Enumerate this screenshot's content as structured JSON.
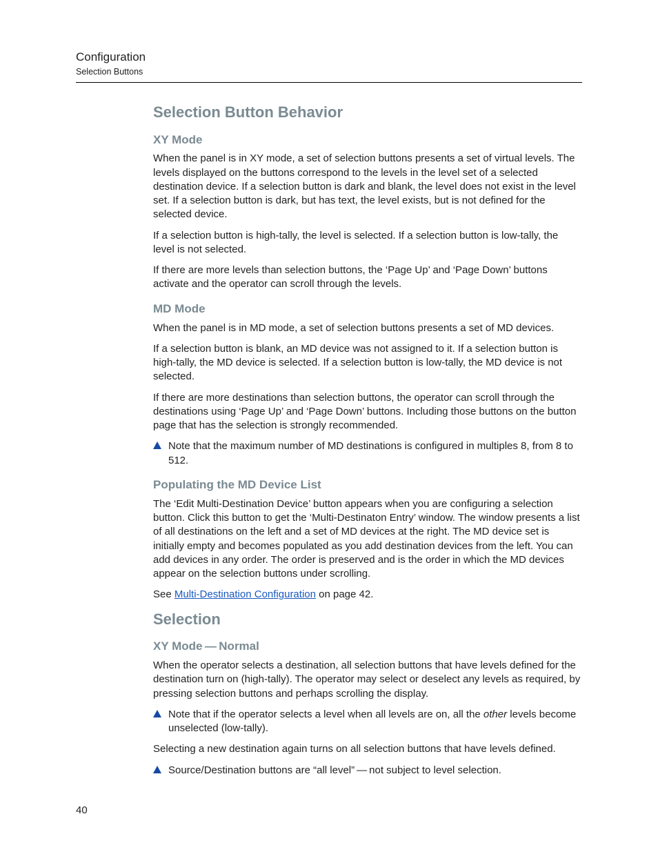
{
  "header": {
    "title": "Configuration",
    "subtitle": "Selection Buttons"
  },
  "pageNumber": "40",
  "sec1": {
    "heading": "Selection Button Behavior",
    "xy": {
      "heading": "XY Mode",
      "p1": "When the panel is in XY mode, a set of selection buttons presents a set of virtual levels. The levels displayed on the buttons correspond to the levels in the level set of a selected destination device. If a selection button is dark and blank, the level does not exist in the level set. If a selection button is dark, but has text, the level exists, but is not defined for the selected device.",
      "p2": "If a selection button is high-tally, the level is selected. If a selection button is low-tally, the level is not selected.",
      "p3": "If there are more levels than selection buttons, the ‘Page Up’ and ‘Page Down’ buttons activate and the operator can scroll through the levels."
    },
    "md": {
      "heading": "MD Mode",
      "p1": "When the panel is in MD mode, a set of selection buttons presents a set of MD devices.",
      "p2": "If a selection button is blank, an MD device was not assigned to it. If a selection button is high-tally, the MD device is selected. If a selection button is low-tally, the MD device is not selected.",
      "p3": "If there are more destinations than selection buttons, the operator can scroll through the destinations using ‘Page Up’ and ‘Page Down’ buttons. Including those buttons on the button page that has the selection is strongly recommended.",
      "note1": "Note that the maximum number of MD destinations is configured in multiples 8, from 8 to 512."
    },
    "pop": {
      "heading": "Populating the MD Device List",
      "p1": "The ‘Edit Multi-Destination Device’ button appears when you are configuring a selection button. Click this button to get the ‘Multi-Destinaton Entry’ window. The window presents a list of all destinations on the left and a set of MD devices at the right. The MD device set is initially empty and becomes populated as you add destination devices from the left. You can add devices in any order. The order is preserved and is the order in which the MD devices appear on the selection buttons under scrolling.",
      "see_prefix": "See ",
      "see_link": "Multi-Destination Configuration",
      "see_suffix": " on page 42."
    }
  },
  "sec2": {
    "heading": "Selection",
    "xyn": {
      "heading": "XY Mode — Normal",
      "p1": "When the operator selects a destination, all selection buttons that have levels defined for the destination turn on (high-tally). The operator may select or deselect any levels as required, by pressing selection buttons and perhaps scrolling the display.",
      "note1_a": "Note that if the operator selects a level when all levels are on, all the ",
      "note1_ital": "other",
      "note1_b": " levels become unselected (low-tally).",
      "p2": "Selecting a new destination again turns on all selection buttons that have levels defined.",
      "note2": "Source/Destination buttons are “all level” — not subject to level selection."
    }
  }
}
